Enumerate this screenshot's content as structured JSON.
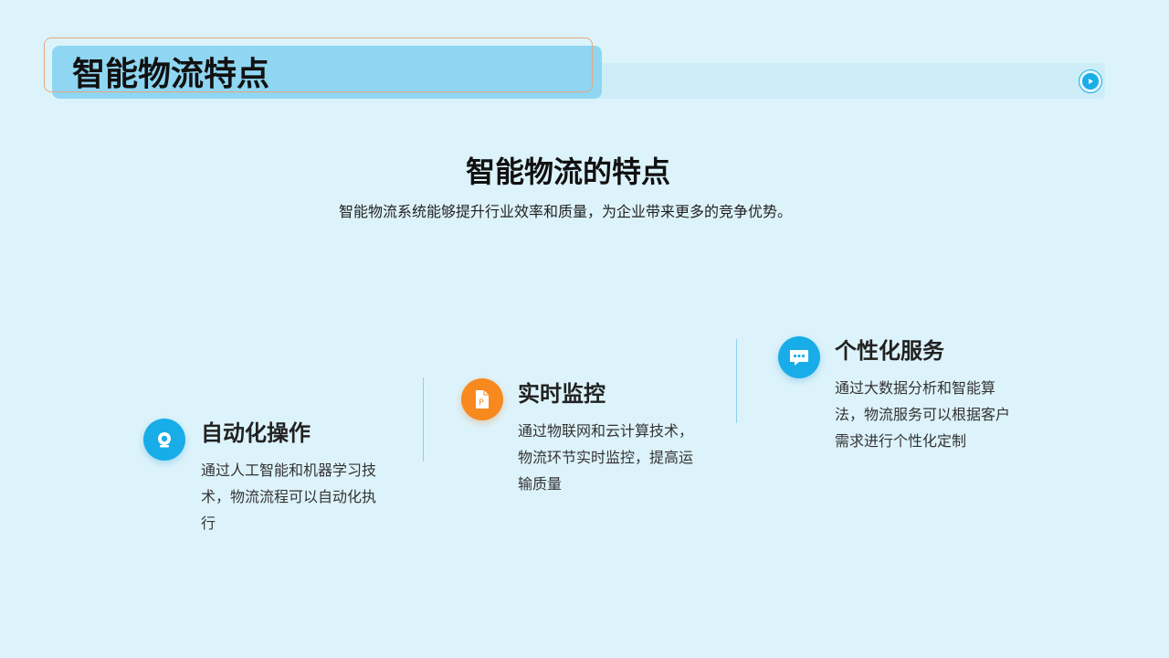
{
  "header": {
    "title": "智能物流特点",
    "play_icon": "play-icon"
  },
  "section": {
    "title": "智能物流的特点",
    "subtitle": "智能物流系统能够提升行业效率和质量，为企业带来更多的竞争优势。"
  },
  "features": [
    {
      "title": "自动化操作",
      "description": "通过人工智能和机器学习技术，物流流程可以自动化执行",
      "icon": "webcam-icon",
      "icon_color": "#18ade8"
    },
    {
      "title": "实时监控",
      "description": "通过物联网和云计算技术，物流环节实时监控，提高运输质量",
      "icon": "document-icon",
      "icon_color": "#f7891f"
    },
    {
      "title": "个性化服务",
      "description": "通过大数据分析和智能算法，物流服务可以根据客户需求进行个性化定制",
      "icon": "chat-icon",
      "icon_color": "#18ade8"
    }
  ],
  "colors": {
    "background": "#ddf3fb",
    "accent_blue": "#18ade8",
    "accent_orange": "#f7891f",
    "title_band": "#8fd6f2",
    "outline": "#e6a87e"
  }
}
